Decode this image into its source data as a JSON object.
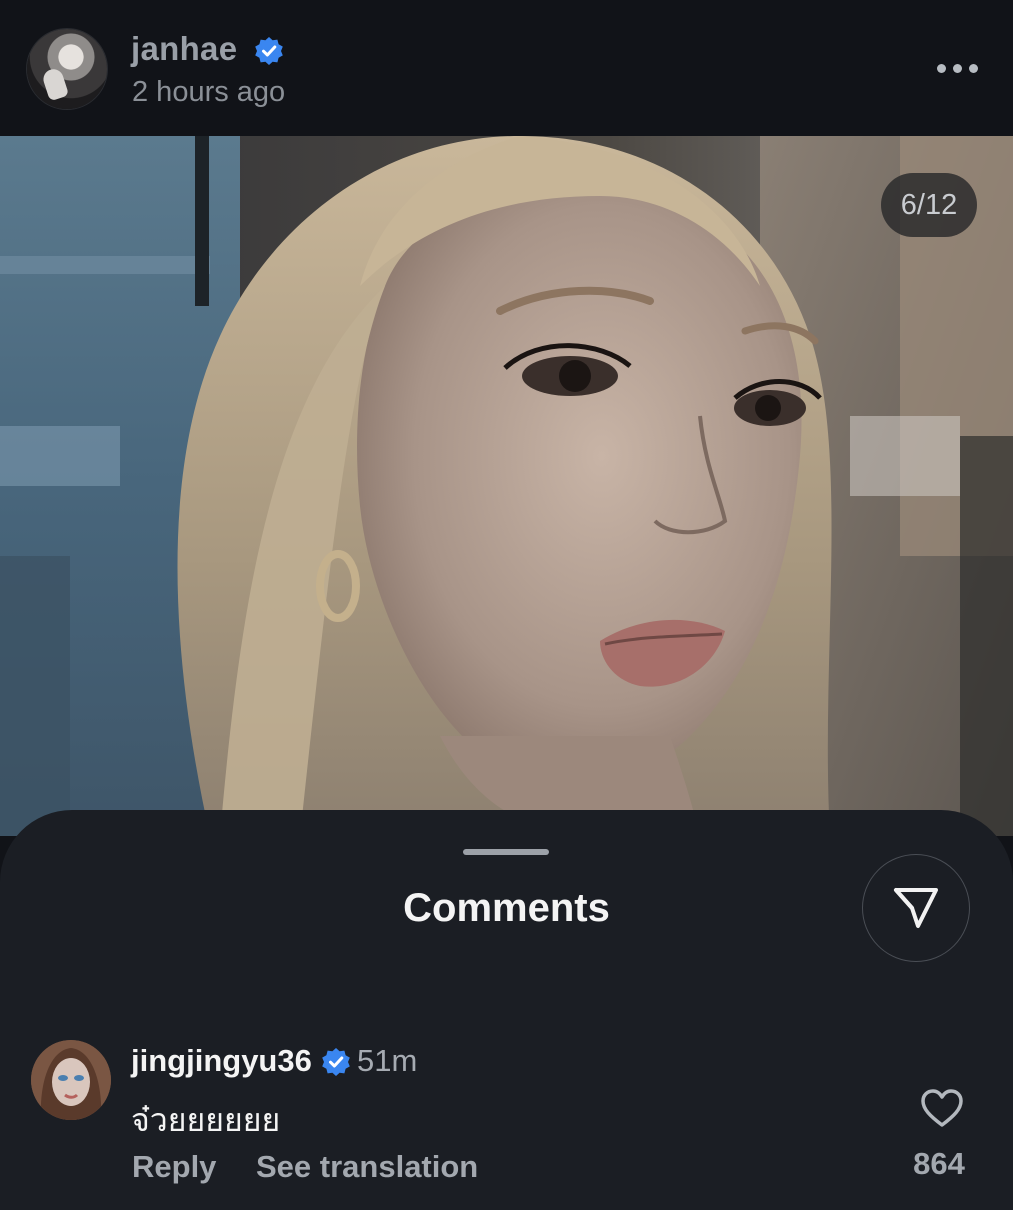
{
  "post": {
    "username": "janhae",
    "verified": true,
    "timestamp": "2 hours ago",
    "menu_icon": "more-horizontal-icon"
  },
  "photo": {
    "counter": "6/12"
  },
  "comments_sheet": {
    "title": "Comments",
    "share_icon": "send-icon"
  },
  "comments": [
    {
      "username": "jingjingyu36",
      "verified": true,
      "time": "51m",
      "text": "จ๋วยยยยยย",
      "reply_label": "Reply",
      "translate_label": "See translation",
      "like_icon": "heart-outline-icon",
      "like_count": "864"
    }
  ],
  "colors": {
    "background": "#111318",
    "sheet": "#1b1e24",
    "verified_badge": "#3a86f0",
    "secondary_text": "#a3a8af"
  }
}
